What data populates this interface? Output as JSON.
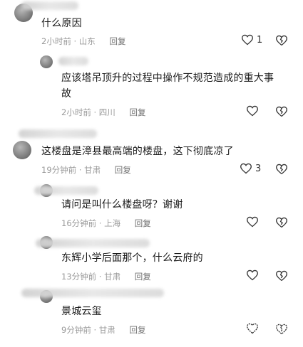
{
  "comments": [
    {
      "text": "什么原因",
      "time": "2小时前",
      "location": "山东",
      "reply_label": "回复",
      "likes": "1"
    },
    {
      "text_line1": "应该塔吊顶升的过程中操作不规范造成的重大事",
      "text_line2": "故",
      "time": "2小时前",
      "location": "四川",
      "reply_label": "回复",
      "likes": ""
    },
    {
      "text": "这楼盘是漳县最高端的楼盘，这下彻底凉了",
      "time": "19分钟前",
      "location": "甘肃",
      "reply_label": "回复",
      "likes": "3"
    },
    {
      "text": "请问是叫什么楼盘呀？谢谢",
      "time": "16分钟前",
      "location": "上海",
      "reply_label": "回复",
      "likes": ""
    },
    {
      "text": "东辉小学后面那个，什么云府的",
      "time": "13分钟前",
      "location": "甘肃",
      "reply_label": "回复",
      "likes": ""
    },
    {
      "text": "景城云玺",
      "time": "9分钟前",
      "location": "甘肃",
      "reply_label": "回复",
      "likes": ""
    }
  ],
  "separator": "·",
  "icons": {
    "like": "heart-outline-icon",
    "dislike": "broken-heart-icon"
  }
}
